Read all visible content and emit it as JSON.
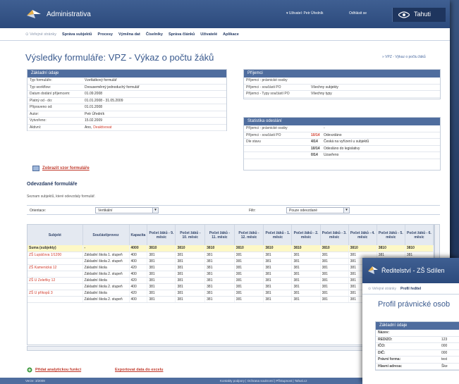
{
  "app": {
    "name": "Administrativa",
    "user": "▾ Uživatel: Petr Úředník",
    "logout": "Odhlásit se",
    "brand": "Tahuti"
  },
  "nav": {
    "home": "⊙ Veřejné stránky",
    "items": [
      "Správa subjektů",
      "Procesy",
      "Výměna dat",
      "Číselníky",
      "Správa článků",
      "Uživatelé",
      "Aplikace"
    ]
  },
  "page": {
    "title": "Výsledky formuláře: VPZ - Výkaz o počtu žáků",
    "crumb": "» VPZ - Výkaz o počtu žáků"
  },
  "basic": {
    "title": "Základní údaje",
    "rows": [
      {
        "k": "Typ formuláře:",
        "v": "Vzefádkový formulář"
      },
      {
        "k": "Typ workflow:",
        "v": "Dvouseměrný jednoduchý formulář"
      },
      {
        "k": "Datum dodání příjemcem:",
        "v": "01.09.2008"
      },
      {
        "k": "Platný od - do:",
        "v": "01.01.2008 - 31.05.2009"
      },
      {
        "k": "Připraveno od:",
        "v": "01.01.2008"
      },
      {
        "k": "Autor:",
        "v": "Petr Úředník"
      },
      {
        "k": "Vytvořeno:",
        "v": "15.02.2009"
      },
      {
        "k": "Aktivní:",
        "v": "Ano,",
        "v2": "Deaktivovat"
      }
    ]
  },
  "recipients": {
    "title": "Příjemci",
    "rows": [
      {
        "k": "Příjemci - právnické osoby",
        "v": ""
      },
      {
        "k": "Příjemci - součásti PO",
        "v": "Všechny subjekty"
      },
      {
        "k": "Příjemci - Typy součástí PO",
        "v": "Všechny typy"
      }
    ]
  },
  "stats": {
    "title": "Statistika odeslání",
    "rows": [
      {
        "k": "Příjemci - právnické osoby",
        "n": "",
        "v": "-"
      },
      {
        "k": "Příjemci - součásti PO",
        "n": "10/14",
        "v": "Odevzdáno"
      },
      {
        "k": "Dle stavu",
        "n": "4/14",
        "v": "Česká na vyřízení u subjektů"
      },
      {
        "k": "",
        "n": "10/14",
        "v": "Odesláno do legislativy"
      },
      {
        "k": "",
        "n": "0/14",
        "v": "Uzavřeno"
      }
    ]
  },
  "show_form_link": "Zobrazit vzor formuláře",
  "submitted": {
    "heading": "Odevzdané formuláře",
    "desc": "Seznam subjektů, které odevzdaly formulář.",
    "orient_label": "Orientace:",
    "orient_value": "Vertikální",
    "filter_label": "Filtr:",
    "filter_value": "Pouze odevzdané"
  },
  "table": {
    "headers": [
      "Subjekt",
      "Součást/provoz",
      "Kapacita",
      "Počet žáků - 9. měsíc",
      "Počet žáků - 10. měsíc",
      "Počet žáků - 11. měsíc",
      "Počet žáků - 12. měsíc",
      "Počet žáků - 1. měsíc",
      "Počet žáků - 2. měsíc",
      "Počet žáků - 3. měsíc",
      "Počet žáků - 4. měsíc",
      "Počet žáků - 5. měsíc",
      "Počet žáků - 6. měsíc"
    ],
    "sum": [
      "Suma (subjekty)",
      "-",
      "4000",
      "3810",
      "3810",
      "3810",
      "3810",
      "3810",
      "3810",
      "3810",
      "3810",
      "3810",
      "3810"
    ],
    "rows": [
      [
        "ZŠ Lupáčova 1/1200",
        "Základní škola 1. stupeň",
        "400",
        "381",
        "381",
        "381",
        "381",
        "381",
        "381",
        "381",
        "381",
        "381",
        "381"
      ],
      [
        "",
        "Základní škola 2. stupeň",
        "400",
        "381",
        "381",
        "381",
        "381",
        "381",
        "381",
        "381",
        "381",
        "381",
        "381"
      ],
      [
        "ZŠ Kamenická 12",
        "Základní škola",
        "420",
        "381",
        "381",
        "381",
        "381",
        "381",
        "381",
        "381",
        "381",
        "381",
        "381"
      ],
      [
        "",
        "Základní škola 2. stupeň",
        "400",
        "381",
        "381",
        "381",
        "381",
        "381",
        "381",
        "381",
        "381",
        "381",
        "381"
      ],
      [
        "ZŠ U Zeleňky 12",
        "Základní škola",
        "420",
        "381",
        "381",
        "381",
        "381",
        "381",
        "381",
        "381",
        "381",
        "381",
        "381"
      ],
      [
        "",
        "Základní škola 2. stupeň",
        "400",
        "381",
        "381",
        "381",
        "381",
        "381",
        "381",
        "381",
        "381",
        "381",
        "381"
      ],
      [
        "ZŠ U příkopů 3",
        "Základní škola",
        "420",
        "381",
        "381",
        "381",
        "381",
        "381",
        "381",
        "381",
        "381",
        "381",
        "381"
      ],
      [
        "",
        "Základní škola 2. stupeň",
        "400",
        "381",
        "381",
        "381",
        "381",
        "381",
        "381",
        "381",
        "381",
        "381",
        "381"
      ]
    ]
  },
  "actions": {
    "add": "Přidat analytickou funkci",
    "export": "Exportovat data do excelu"
  },
  "footer": {
    "version": "Verze: 3/2009",
    "links": "Kontakty podpory | Ochrana soukromí | Přístupnost | Tahuti.cz"
  },
  "win2": {
    "title": "Ředitelství - ZŠ Sdílen",
    "nav_home": "⊙ Veřejné stránky",
    "nav_item": "Profil ředitel",
    "page_title": "Profil právnické osob",
    "box_title": "Základní údaje",
    "rows": [
      {
        "k": "Název:",
        "v": ""
      },
      {
        "k": "REDIZO:",
        "v": "123"
      },
      {
        "k": "IČO:",
        "v": "000"
      },
      {
        "k": "DIČ:",
        "v": "000"
      },
      {
        "k": "Právní forma:",
        "v": "test"
      },
      {
        "k": "Hlavní adresa:",
        "v": "Ške"
      }
    ]
  }
}
